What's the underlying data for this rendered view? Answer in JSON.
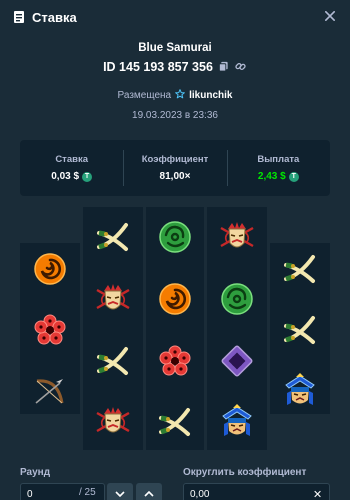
{
  "header": {
    "title": "Ставка",
    "icon": "receipt-icon"
  },
  "game": {
    "name": "Blue Samurai",
    "bet_id": "ID 145 193 857 356"
  },
  "placed": {
    "label": "Размещена",
    "user": "likunchik"
  },
  "datetime": "19.03.2023 в 23:36",
  "stats": {
    "bet_label": "Ставка",
    "bet_value": "0,03 $",
    "multiplier_label": "Коэффициент",
    "multiplier_value": "81,00×",
    "payout_label": "Выплата",
    "payout_value": "2,43 $"
  },
  "currency_symbol": "T",
  "reels": [
    [
      "orange-spiral",
      "red-flower",
      "bow"
    ],
    [
      "swords",
      "samurai-mask",
      "swords",
      "samurai-mask"
    ],
    [
      "green-spiral",
      "orange-spiral",
      "red-flower",
      "swords"
    ],
    [
      "samurai-mask",
      "green-spiral",
      "purple-diamond",
      "blue-samurai"
    ],
    [
      "swords",
      "swords",
      "blue-samurai"
    ]
  ],
  "footer": {
    "round_label": "Раунд",
    "round_value": "0",
    "round_total": "/ 25",
    "round_coef_label": "Округлить коэффициент",
    "round_coef_value": "0,00"
  },
  "colors": {
    "background": "#1a2c38",
    "panel": "#0f212e",
    "muted_text": "#b1bad3",
    "payout_green": "#00e701",
    "coin": "#26a17b"
  }
}
